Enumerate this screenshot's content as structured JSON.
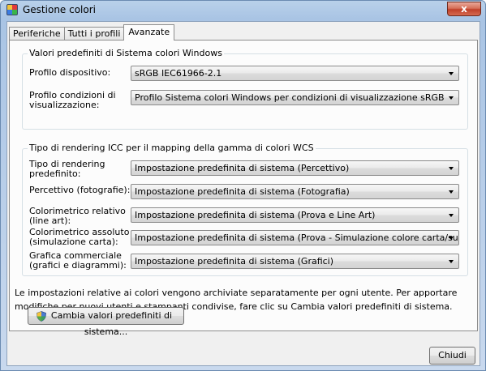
{
  "window": {
    "title": "Gestione colori",
    "close_glyph": "x"
  },
  "tabs": [
    {
      "label": "Periferiche",
      "active": false
    },
    {
      "label": "Tutti i profili",
      "active": false
    },
    {
      "label": "Avanzate",
      "active": true
    }
  ],
  "windows_defaults": {
    "title": "Valori predefiniti di Sistema colori Windows",
    "device_profile_label": "Profilo dispositivo:",
    "device_profile_value": "sRGB IEC61966-2.1",
    "viewing_conditions_label_1": "Profilo condizioni di",
    "viewing_conditions_label_2": "visualizzazione:",
    "viewing_conditions_value": "Profilo Sistema colori Windows per condizioni di visualizzazione sRGB"
  },
  "icc_rendering": {
    "title": "Tipo di rendering ICC per il mapping della gamma di colori WCS",
    "rows": [
      {
        "label_1": "Tipo di rendering",
        "label_2": "predefinito:",
        "value": "Impostazione predefinita di sistema (Percettivo)"
      },
      {
        "label_1": "Percettivo (fotografie):",
        "label_2": "",
        "value": "Impostazione predefinita di sistema (Fotografia)"
      },
      {
        "label_1": "Colorimetrico relativo",
        "label_2": "(line art):",
        "value": "Impostazione predefinita di sistema (Prova e Line Art)"
      },
      {
        "label_1": "Colorimetrico assoluto",
        "label_2": "(simulazione carta):",
        "value": "Impostazione predefinita di sistema (Prova - Simulazione colore carta/supporto)"
      },
      {
        "label_1": "Grafica commerciale",
        "label_2": "(grafici e diagrammi):",
        "value": "Impostazione predefinita di sistema (Grafici)"
      }
    ]
  },
  "info_text": "Le impostazioni relative ai colori vengono archiviate separatamente per ogni utente. Per apportare modifiche per nuovi utenti e stampanti condivise, fare clic su Cambia valori predefiniti di sistema.",
  "buttons": {
    "change_defaults": "Cambia valori predefiniti di sistema...",
    "close": "Chiudi"
  },
  "icons": {
    "app": "color-management-icon",
    "shield": "uac-shield-icon"
  }
}
